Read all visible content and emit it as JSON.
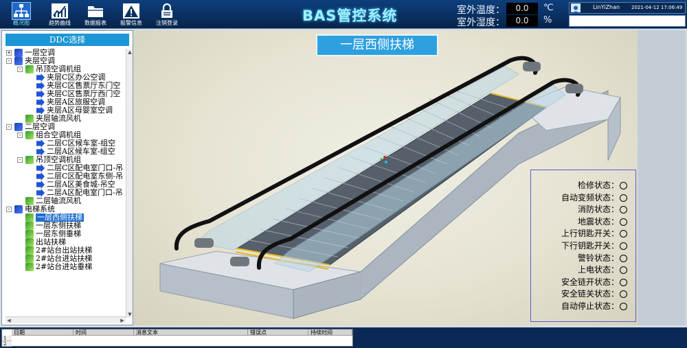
{
  "toolbar": {
    "buttons": [
      {
        "label": "概况图",
        "icon": "network-icon",
        "active": true
      },
      {
        "label": "趋势曲线",
        "icon": "trend-chart-icon",
        "active": false
      },
      {
        "label": "数据报表",
        "icon": "folder-icon",
        "active": false
      },
      {
        "label": "报警信息",
        "icon": "warning-icon",
        "active": false
      },
      {
        "label": "注销登录",
        "icon": "lock-icon",
        "active": false
      }
    ]
  },
  "header": {
    "title": "BAS管控系统",
    "outdoor_temp_label": "室外温度：",
    "outdoor_temp_value": "0.0",
    "outdoor_temp_unit": "℃",
    "outdoor_humidity_label": "室外湿度：",
    "outdoor_humidity_value": "0.0",
    "outdoor_humidity_unit": "%",
    "user_name": "LinYiZhan",
    "datetime": "2021-04-12 17:06:49"
  },
  "ddc_panel": {
    "header": "DDC选择",
    "tree": [
      {
        "label": "一层空调",
        "level": 0,
        "expander": "+",
        "icon": "building"
      },
      {
        "label": "夹层空调",
        "level": 0,
        "expander": "-",
        "icon": "building"
      },
      {
        "label": "吊顶空调机组",
        "level": 1,
        "expander": "-",
        "icon": "group"
      },
      {
        "label": "夹层C区办公空调",
        "level": 2,
        "expander": "",
        "icon": "device"
      },
      {
        "label": "夹层C区售票厅东门空",
        "level": 2,
        "expander": "",
        "icon": "device"
      },
      {
        "label": "夹层C区售票厅西门空",
        "level": 2,
        "expander": "",
        "icon": "device"
      },
      {
        "label": "夹层A区旅服空调",
        "level": 2,
        "expander": "",
        "icon": "device"
      },
      {
        "label": "夹层A区母婴室空调",
        "level": 2,
        "expander": "",
        "icon": "device"
      },
      {
        "label": "夹层轴流风机",
        "level": 1,
        "expander": "",
        "icon": "group"
      },
      {
        "label": "二层空调",
        "level": 0,
        "expander": "-",
        "icon": "building"
      },
      {
        "label": "组合空调机组",
        "level": 1,
        "expander": "-",
        "icon": "group"
      },
      {
        "label": "二层C区候车室-组空",
        "level": 2,
        "expander": "",
        "icon": "device"
      },
      {
        "label": "二层A区候车室-组空",
        "level": 2,
        "expander": "",
        "icon": "device"
      },
      {
        "label": "吊顶空调机组",
        "level": 1,
        "expander": "-",
        "icon": "group"
      },
      {
        "label": "二层C区配电室门口-吊",
        "level": 2,
        "expander": "",
        "icon": "device"
      },
      {
        "label": "二层C区配电室东侧-吊",
        "level": 2,
        "expander": "",
        "icon": "device"
      },
      {
        "label": "二层A区美食城-吊空",
        "level": 2,
        "expander": "",
        "icon": "device"
      },
      {
        "label": "二层A区配电室门口-吊",
        "level": 2,
        "expander": "",
        "icon": "device"
      },
      {
        "label": "二层轴流风机",
        "level": 1,
        "expander": "",
        "icon": "group"
      },
      {
        "label": "电梯系统",
        "level": 0,
        "expander": "-",
        "icon": "building"
      },
      {
        "label": "一层西侧扶梯",
        "level": 1,
        "expander": "",
        "icon": "group",
        "selected": true
      },
      {
        "label": "一层东侧扶梯",
        "level": 1,
        "expander": "",
        "icon": "group"
      },
      {
        "label": "一层东侧垂梯",
        "level": 1,
        "expander": "",
        "icon": "group"
      },
      {
        "label": "出站扶梯",
        "level": 1,
        "expander": "",
        "icon": "group"
      },
      {
        "label": "2#站台出站扶梯",
        "level": 1,
        "expander": "",
        "icon": "group"
      },
      {
        "label": "2#站台进站扶梯",
        "level": 1,
        "expander": "",
        "icon": "group"
      },
      {
        "label": "2#站台进站垂梯",
        "level": 1,
        "expander": "",
        "icon": "group"
      }
    ]
  },
  "device_view": {
    "title": "一层西侧扶梯"
  },
  "status_panel": {
    "items": [
      "检修状态：",
      "自动变频状态：",
      "消防状态：",
      "地震状态：",
      "上行钥匙开关：",
      "下行钥匙开关：",
      "警铃状态：",
      "上电状态：",
      "安全链开状态：",
      "安全链关状态：",
      "自动停止状态："
    ]
  },
  "alarm_table": {
    "columns": [
      "日期",
      "时间",
      "消息文本",
      "错误点",
      "持续时间"
    ],
    "row_numbers": [
      "1",
      "2"
    ]
  },
  "colors": {
    "topbar": "#0a2f60",
    "title_cyan": "#9ff0ff",
    "panel_header": "#1b96d6",
    "selected": "#1f6fd0",
    "status_border": "#5a5ad0"
  }
}
